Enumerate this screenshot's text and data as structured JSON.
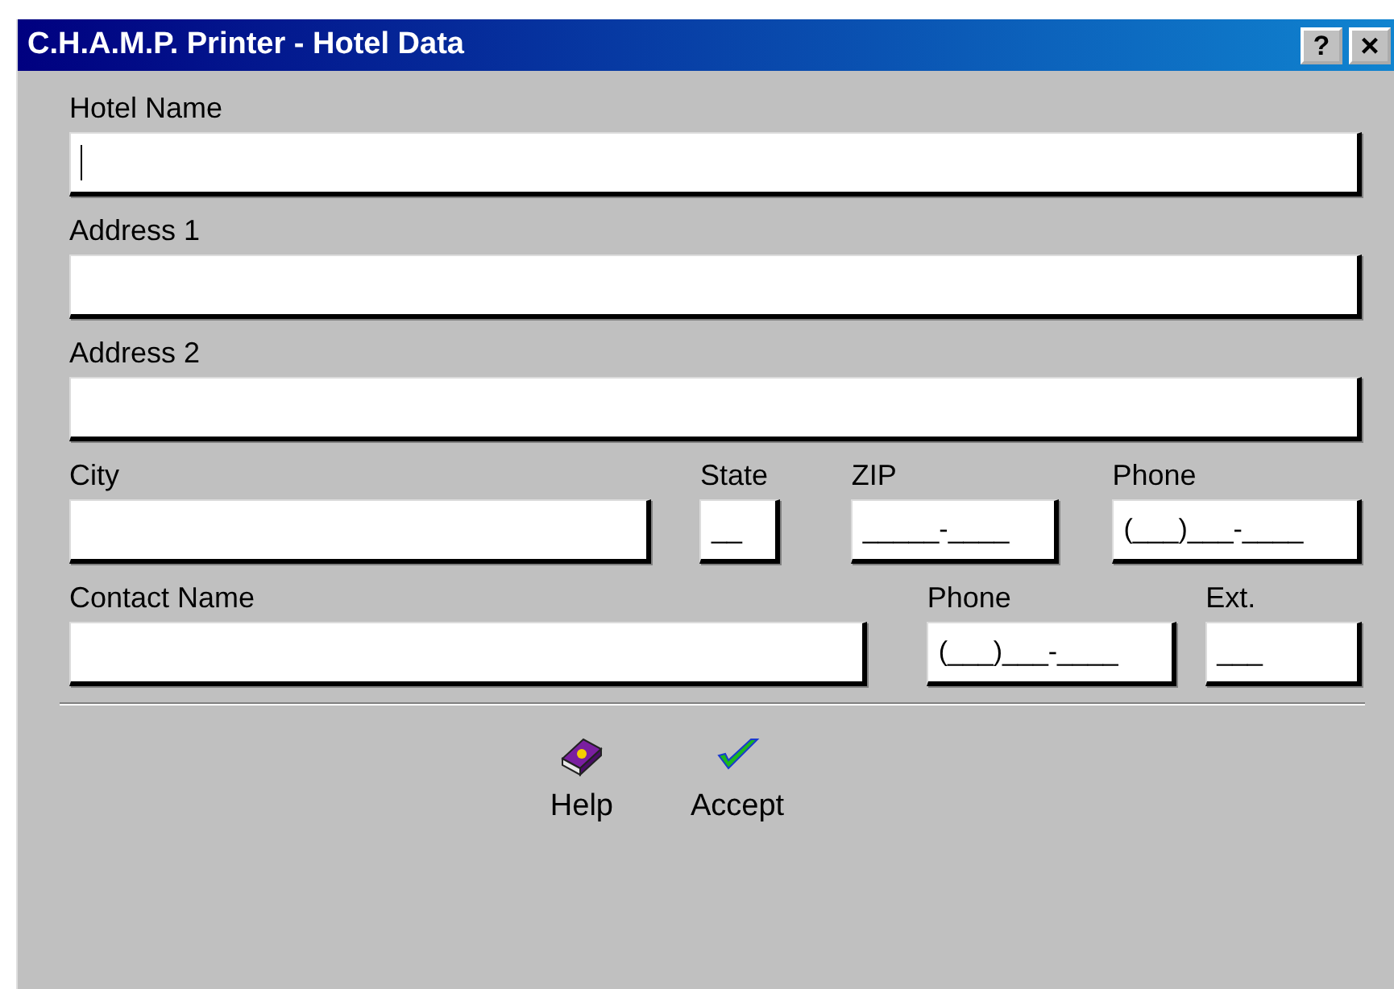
{
  "window": {
    "title": "C.H.A.M.P. Printer - Hotel Data",
    "title_buttons": [
      {
        "kind": "help",
        "label": "?"
      },
      {
        "kind": "close",
        "label": "×"
      }
    ]
  },
  "rows": [
    {
      "fields": [
        {
          "label": "Hotel Name",
          "focused": true
        }
      ]
    },
    {
      "fields": [
        {
          "label": "Address 1",
          "focused": false
        }
      ]
    },
    {
      "fields": [
        {
          "label": "Address 2",
          "focused": false
        }
      ]
    },
    {
      "fields": [
        {
          "label": "City",
          "focused": false
        },
        {
          "label": "State",
          "value": "__",
          "focused": false
        },
        {
          "label": "ZIP",
          "value": "_____-____",
          "focused": false
        },
        {
          "label": "Phone",
          "value": "(___)___-____",
          "focused": false
        }
      ]
    },
    {
      "fields": [
        {
          "label": "Contact Name",
          "focused": false
        },
        {
          "label": "Phone",
          "value": "(___)___-____",
          "focused": false
        },
        {
          "label": "Ext.",
          "value": "___",
          "focused": false
        }
      ]
    }
  ],
  "buttons": [
    {
      "kind": "help",
      "label": "Help"
    },
    {
      "kind": "accept",
      "label": "Accept"
    }
  ]
}
